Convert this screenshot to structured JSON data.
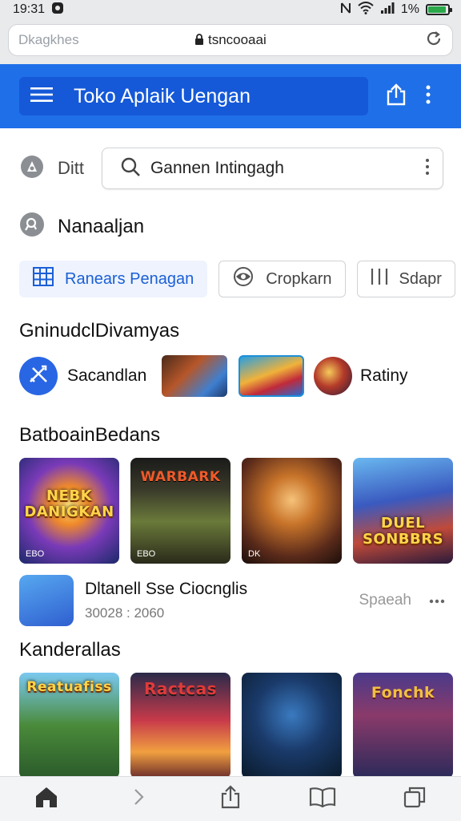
{
  "status_bar": {
    "time": "19:31",
    "battery_pct": "1%",
    "battery_level": 0.9
  },
  "browser": {
    "tab_hint": "Dkagkhes",
    "url": "tsncooaai"
  },
  "header": {
    "title": "Toko Aplaik Uengan"
  },
  "search": {
    "filter_label": "Ditt",
    "placeholder": "Gannen Intingagh"
  },
  "location": {
    "label": "Nanaaljan"
  },
  "chips": [
    {
      "label": "Ranears Penagan",
      "icon": "grid-icon",
      "active": true
    },
    {
      "label": "Cropkarn",
      "icon": "eye-icon",
      "active": false
    },
    {
      "label": "Sdapr",
      "icon": "bars-icon",
      "active": false
    }
  ],
  "section_categories": {
    "title": "GninudclDivamyas"
  },
  "categories": {
    "first_label": "Sacandlan",
    "last_label": "Ratiny"
  },
  "section_popular": {
    "title": "BatboainBedans"
  },
  "popular_games": [
    {
      "art": "NEBK DANIGKAN",
      "corner": "EBO"
    },
    {
      "art": "WARBARK",
      "corner": "EBO"
    },
    {
      "art": "",
      "corner": "DK"
    },
    {
      "art": "DUEL SONBBRS",
      "corner": ""
    }
  ],
  "featured": {
    "title": "Dltanell Sse Ciocnglis",
    "subtitle": "30028 : 2060",
    "action": "Spaeah"
  },
  "section_new": {
    "title": "Kanderallas"
  },
  "new_games": [
    {
      "art": "Reatuafiss"
    },
    {
      "art": "Ractcas"
    },
    {
      "art": ""
    },
    {
      "art": "Fonchk"
    }
  ],
  "colors": {
    "brand": "#1f6fe8",
    "accent": "#2966e4",
    "chip_active_text": "#1b5fd6"
  }
}
